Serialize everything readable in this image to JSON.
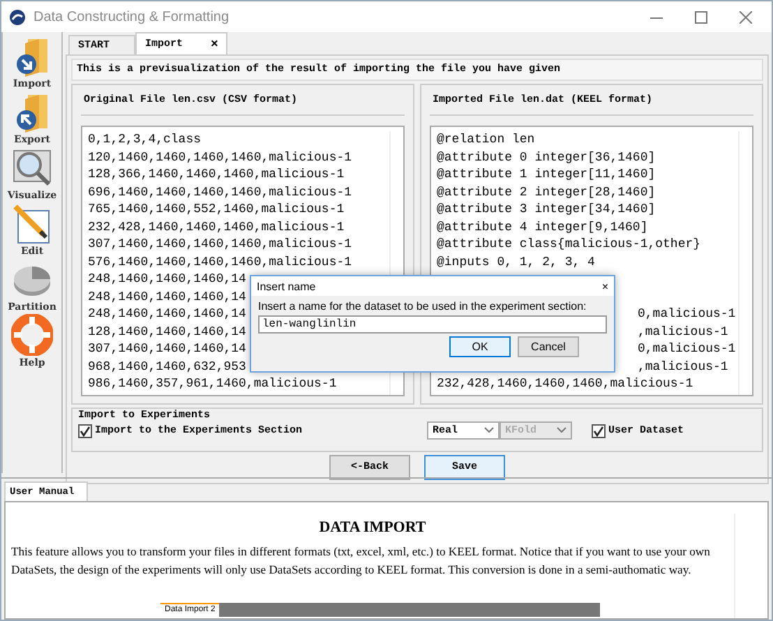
{
  "window": {
    "title": "Data Constructing & Formatting"
  },
  "toolbar": [
    {
      "kind": "import",
      "label": "Import"
    },
    {
      "kind": "export",
      "label": "Export"
    },
    {
      "kind": "visualize",
      "label": "Visualize"
    },
    {
      "kind": "edit",
      "label": "Edit"
    },
    {
      "kind": "partition",
      "label": "Partition"
    },
    {
      "kind": "help",
      "label": "Help"
    }
  ],
  "tabs": [
    {
      "label": "START",
      "selected": false
    },
    {
      "label": "Import",
      "selected": true,
      "close": "×"
    }
  ],
  "info": "This is a previsualization of the result of importing the file you have given",
  "original_panel": {
    "title": "Original File len.csv (CSV  format)",
    "rows": [
      {
        "text": "0,1,2,3,4,class"
      },
      {
        "text": "120,1460,1460,1460,1460,malicious-1"
      },
      {
        "text": "128,366,1460,1460,1460,malicious-1"
      },
      {
        "text": "696,1460,1460,1460,1460,malicious-1"
      },
      {
        "text": "765,1460,1460,552,1460,malicious-1"
      },
      {
        "text": "232,428,1460,1460,1460,malicious-1"
      },
      {
        "text": "307,1460,1460,1460,1460,malicious-1"
      },
      {
        "text": "576,1460,1460,1460,1460,malicious-1"
      },
      {
        "text": "248,1460,1460,1460,14"
      },
      {
        "text": "248,1460,1460,1460,14"
      },
      {
        "text": "248,1460,1460,1460,14"
      },
      {
        "text": "128,1460,1460,1460,14"
      },
      {
        "text": "307,1460,1460,1460,14"
      },
      {
        "text": "968,1460,1460,632,953"
      },
      {
        "text": "986,1460,357,961,1460,malicious-1"
      }
    ]
  },
  "imported_panel": {
    "title": "Imported File len.dat (KEEL format)",
    "rows": [
      {
        "kind": "full",
        "text": "@relation len"
      },
      {
        "kind": "full",
        "text": "@attribute 0 integer[36,1460]"
      },
      {
        "kind": "full",
        "text": "@attribute 1 integer[11,1460]"
      },
      {
        "kind": "full",
        "text": "@attribute 2 integer[28,1460]"
      },
      {
        "kind": "full",
        "text": "@attribute 3 integer[34,1460]"
      },
      {
        "kind": "full",
        "text": "@attribute 4 integer[9,1460]"
      },
      {
        "kind": "full",
        "text": "@attribute class{malicious-1,other}"
      },
      {
        "kind": "full",
        "text": "@inputs 0, 1, 2, 3, 4"
      },
      {
        "kind": "cut",
        "text": "0,malicious-1"
      },
      {
        "kind": "cut",
        "text": ",malicious-1"
      },
      {
        "kind": "cut",
        "text": "0,malicious-1"
      },
      {
        "kind": "cut",
        "text": ",malicious-1"
      },
      {
        "kind": "full",
        "text": "232,428,1460,1460,1460,malicious-1"
      }
    ]
  },
  "experiments": {
    "title": "Import to Experiments",
    "checkbox": {
      "label": "Import to the Experiments Section",
      "checked": true
    },
    "type_select": "Real",
    "partition_select": {
      "value": "KFold",
      "disabled": true
    },
    "user_dataset": {
      "label": "User Dataset",
      "checked": true
    }
  },
  "buttons": [
    {
      "label": "<-Back",
      "focused": false
    },
    {
      "label": "Save",
      "focused": true
    }
  ],
  "manual": {
    "tab": "User Manual",
    "heading": "DATA IMPORT",
    "paragraph": "This feature allows you to transform your files in different formats (txt, excel, xml, etc.) to KEEL format. Notice that if you want to use your own DataSets, the design of the experiments will only use DataSets according to KEEL format. This conversion is done in a semi-authomatic way."
  },
  "dialog": {
    "title": "Insert name",
    "close": "×",
    "message": "Insert a name for the dataset to be used in the experiment section:",
    "value": "len-wanglinlin",
    "buttons": [
      {
        "label": "OK",
        "focused": true
      },
      {
        "label": "Cancel",
        "focused": false
      }
    ]
  },
  "taskbar_preview": {
    "label": "Data Import 2"
  }
}
